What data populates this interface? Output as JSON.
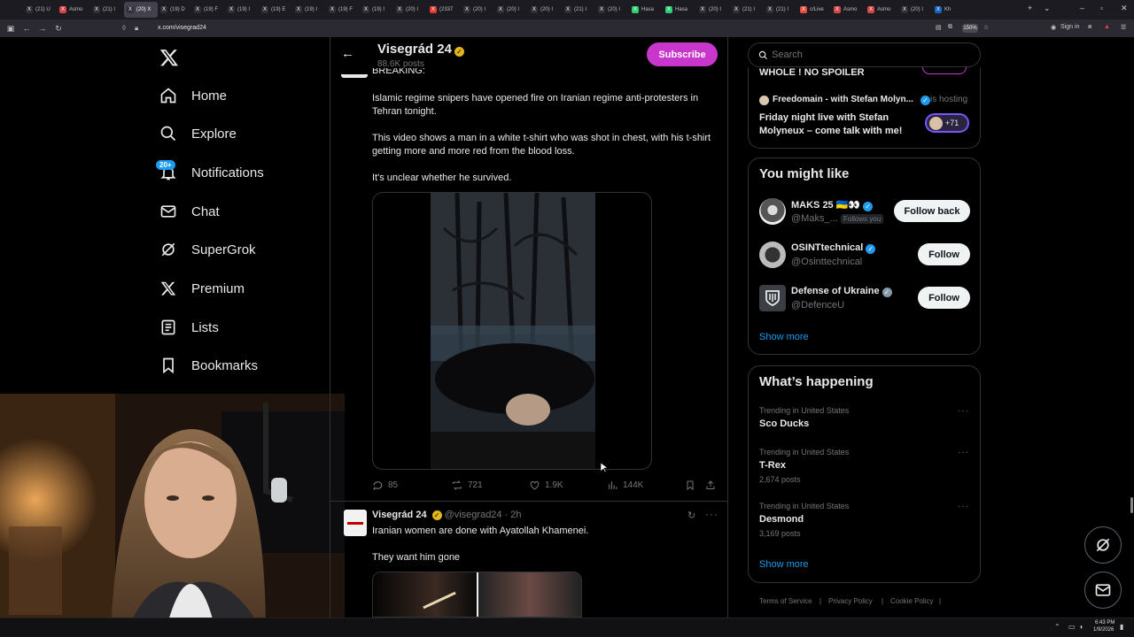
{
  "browser": {
    "tabs": [
      "(21) U",
      "Asmo",
      "(21) I",
      "(20) X",
      "(19) D",
      "(19) F",
      "(19) I",
      "(19) E",
      "(19) I",
      "(19) F",
      "(19) I",
      "(20) I",
      "(2337",
      "(20) I",
      "(20) I",
      "(20) I",
      "(21) I",
      "(20) I",
      "Hasa",
      "Hasa",
      "(20) I",
      "(21) I",
      "(21) I",
      "c/Live",
      "Asmo",
      "Asmo",
      "(20) I",
      "Kh"
    ],
    "url": "x.com/visegrad24",
    "zoom": "150%",
    "sign_in": "Sign in"
  },
  "nav": {
    "items": [
      {
        "label": "Home",
        "icon": "home-icon"
      },
      {
        "label": "Explore",
        "icon": "search-icon"
      },
      {
        "label": "Notifications",
        "icon": "bell-icon"
      },
      {
        "label": "Chat",
        "icon": "mail-icon"
      },
      {
        "label": "SuperGrok",
        "icon": "grok-icon"
      },
      {
        "label": "Premium",
        "icon": "x-logo-icon"
      },
      {
        "label": "Lists",
        "icon": "list-icon"
      },
      {
        "label": "Bookmarks",
        "icon": "bookmark-icon"
      }
    ],
    "notifications_badge": "20+"
  },
  "profile_header": {
    "name": "Visegrád 24",
    "posts": "88.6K posts",
    "subscribe": "Subscribe"
  },
  "tweet1": {
    "heading": "BREAKING:",
    "p1": "Islamic regime snipers have opened fire on Iranian regime anti-protesters in Tehran tonight.",
    "p2": "This video shows a man in a white t-shirt who was shot in chest, with his t-shirt getting more and more red from the blood loss.",
    "p3": "It's unclear whether he survived.",
    "replies": "85",
    "reposts": "721",
    "likes": "1.9K",
    "views": "144K"
  },
  "tweet2": {
    "name": "Visegrád 24",
    "handle": "@visegrad24",
    "time": "· 2h",
    "text1": "Iranian women are done with Ayatollah Khamenei.",
    "text2": "They want him gone"
  },
  "search": {
    "placeholder": "Search"
  },
  "spaces": {
    "top_title": "WHOLE ! NO SPOILER",
    "host": "Freedomain - with Stefan Molyn...",
    "is_hosting": "is hosting",
    "title": "Friday night live with Stefan Molyneux – come talk with me!",
    "listeners": "+71"
  },
  "might_like": {
    "title": "You might like",
    "users": [
      {
        "name": "MAKS 25 🇺🇦👀",
        "handle": "@Maks_...",
        "follows_you": "Follows you",
        "button": "Follow back"
      },
      {
        "name": "OSINTtechnical",
        "handle": "@Osinttechnical",
        "button": "Follow"
      },
      {
        "name": "Defense of Ukraine",
        "handle": "@DefenceU",
        "button": "Follow"
      }
    ],
    "show_more": "Show more"
  },
  "happening": {
    "title": "What’s happening",
    "trends": [
      {
        "category": "Trending in United States",
        "name": "Sco Ducks",
        "count": ""
      },
      {
        "category": "Trending in United States",
        "name": "T-Rex",
        "count": "2,674 posts"
      },
      {
        "category": "Trending in United States",
        "name": "Desmond",
        "count": "3,169 posts"
      }
    ],
    "show_more": "Show more"
  },
  "footer": {
    "terms": "Terms of Service",
    "privacy": "Privacy Policy",
    "cookie": "Cookie Policy"
  },
  "taskbar": {
    "time": "6:43 PM",
    "date": "1/9/2026"
  },
  "colors": {
    "accent_blue": "#1d9bf0",
    "subscribe_purple": "#c936cc",
    "gold_verified": "#e2b719"
  }
}
